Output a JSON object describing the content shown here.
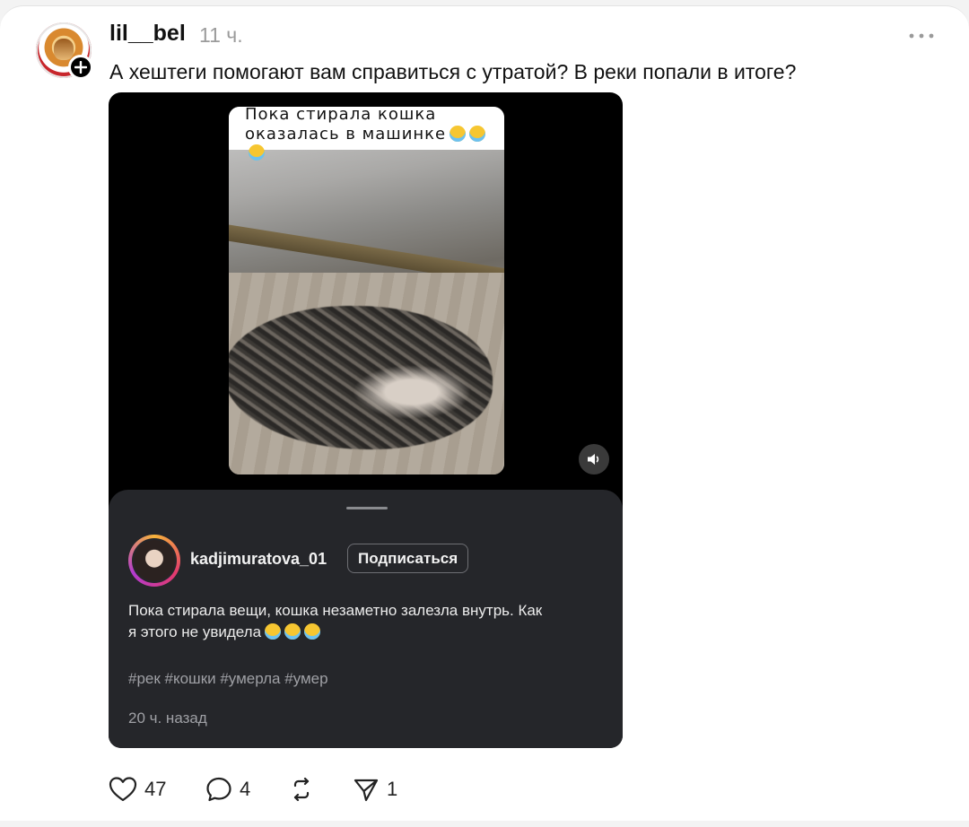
{
  "post": {
    "username": "lil__bel",
    "time": "11 ч.",
    "text": "А хештеги помогают вам справиться с утратой? В реки попали в итоге?",
    "more_icon": "more-horizontal-icon"
  },
  "media": {
    "video_caption_line1": "Пока  стирала  кошка",
    "video_caption_line2": "оказалась  в  машинке",
    "sound_icon": "speaker-icon",
    "embed": {
      "username": "kadjimuratova_01",
      "subscribe_label": "Подписаться",
      "text_line1": "Пока стирала вещи, кошка незаметно залезла внутрь. Как",
      "text_line2": "я этого не увидела",
      "hashtags": "#рек #кошки #умерла #умер",
      "time_ago": "20 ч. назад"
    }
  },
  "actions": {
    "likes": "47",
    "comments": "4",
    "reposts": "",
    "shares": "1"
  },
  "colors": {
    "sheet_bg": "#25262a",
    "text_primary": "#111111",
    "text_muted": "#9b9b9b"
  }
}
